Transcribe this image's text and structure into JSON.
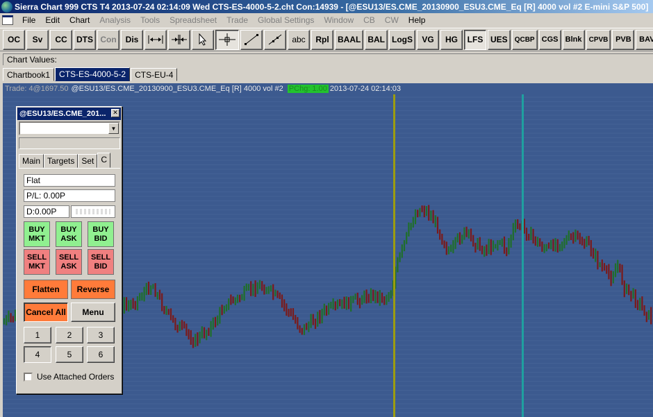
{
  "window": {
    "title": "Sierra Chart 999 CTS T4 2013-07-24  02:14:09 Wed  CTS-ES-4000-5-2.cht Con:14939 - [@ESU13/ES.CME_20130900_ESU3.CME_Eq [R]  4000 vol  #2  E-mini S&P 500]"
  },
  "menu": {
    "items": [
      {
        "label": "File",
        "disabled": false
      },
      {
        "label": "Edit",
        "disabled": false
      },
      {
        "label": "Chart",
        "disabled": false
      },
      {
        "label": "Analysis",
        "disabled": true
      },
      {
        "label": "Tools",
        "disabled": true
      },
      {
        "label": "Spreadsheet",
        "disabled": true
      },
      {
        "label": "Trade",
        "disabled": true
      },
      {
        "label": "Global Settings",
        "disabled": true
      },
      {
        "label": "Window",
        "disabled": true
      },
      {
        "label": "CB",
        "disabled": true
      },
      {
        "label": "CW",
        "disabled": true
      },
      {
        "label": "Help",
        "disabled": false
      }
    ]
  },
  "toolbar": {
    "buttons": {
      "oc": "OC",
      "sv": "Sv",
      "cc": "CC",
      "dts": "DTS",
      "con": "Con",
      "dis": "Dis",
      "abc": "abc",
      "rpl": "Rpl",
      "baal": "BAAL",
      "bal": "BAL",
      "logs": "LogS",
      "vg": "VG",
      "hg": "HG",
      "lfs": "LFS",
      "ues": "UES",
      "qcbp": "QCBP",
      "cgs": "CGS",
      "blnk": "Blnk",
      "cpvb": "CPVB",
      "pvb": "PVB",
      "bav": "BAV"
    }
  },
  "chart_values": {
    "label": "Chart Values:"
  },
  "tabs": [
    {
      "label": "Chartbook1",
      "active": false
    },
    {
      "label": "CTS-ES-4000-5-2",
      "active": true
    },
    {
      "label": "CTS-EU-4",
      "active": false
    }
  ],
  "chart_header": {
    "trade": "Trade: 4@1697.50",
    "symbol": "@ESU13/ES.CME_20130900_ESU3.CME_Eq [R]  4000 vol  #2",
    "pchg": "PChg: 1.00",
    "datetime": "2013-07-24  02:14:03"
  },
  "colors": {
    "chart_bg": "#3c5a8f",
    "gridline": "#5a78a8",
    "up_bar": "#1f6e2a",
    "down_bar": "#7a1a1a",
    "vline_yellow": "#9c9c10",
    "vline_teal": "#1fa0a0",
    "buy_button": "#90f090",
    "sell_button": "#f08080",
    "flatten_button": "#ff7b3a"
  },
  "trade_window": {
    "title": "@ESU13/ES.CME_201...",
    "tabs": [
      "Main",
      "Targets",
      "Set",
      "C"
    ],
    "position": "Flat",
    "pnl": "P/L: 0.00P",
    "daily": "D:0.00P",
    "buy_mkt": "BUY MKT",
    "buy_ask": "BUY ASK",
    "buy_bid": "BUY BID",
    "sell_mkt": "SELL MKT",
    "sell_ask": "SELL ASK",
    "sell_bid": "SELL BID",
    "flatten": "Flatten",
    "reverse": "Reverse",
    "cancel_all": "Cancel All",
    "menu": "Menu",
    "numbers": [
      "1",
      "2",
      "3",
      "4",
      "5",
      "6"
    ],
    "use_attached": "Use Attached Orders"
  }
}
